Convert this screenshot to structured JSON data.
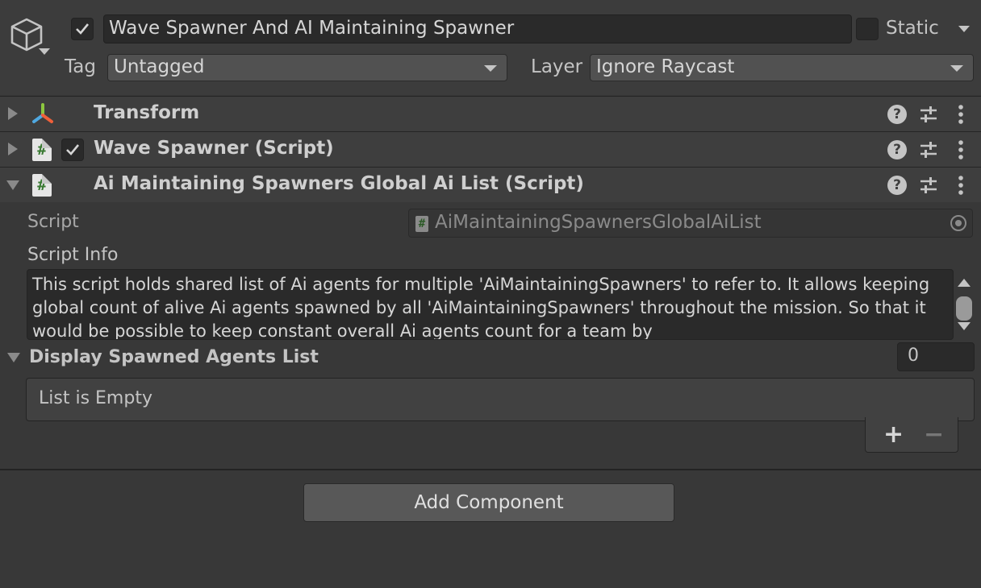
{
  "header": {
    "object_name": "Wave Spawner And AI Maintaining Spawner",
    "active_checked": true,
    "static_label": "Static",
    "tag_label": "Tag",
    "tag_value": "Untagged",
    "layer_label": "Layer",
    "layer_value": "Ignore Raycast"
  },
  "components": [
    {
      "title": "Transform",
      "expanded": false
    },
    {
      "title": "Wave Spawner (Script)",
      "expanded": false,
      "enabled": true
    },
    {
      "title": "Ai Maintaining Spawners Global Ai List (Script)",
      "expanded": true
    }
  ],
  "script_component": {
    "script_label": "Script",
    "script_value": "AiMaintainingSpawnersGlobalAiList",
    "info_label": "Script Info",
    "info_text": "This script holds shared list of Ai agents for multiple 'AiMaintainingSpawners' to refer to. It allows keeping global count of alive Ai agents spawned by all 'AiMaintainingSpawners' throughout the mission. So that it would be possible to keep constant overall Ai agents count for a team by",
    "list_label": "Display Spawned Agents List",
    "list_count": "0",
    "list_empty_text": "List is Empty",
    "add_symbol": "+",
    "remove_symbol": "−"
  },
  "add_component_label": "Add Component",
  "colors": {
    "background": "#383838",
    "header": "#3c3c3c",
    "field": "#2a2a2a",
    "text": "#c4c4c4"
  }
}
